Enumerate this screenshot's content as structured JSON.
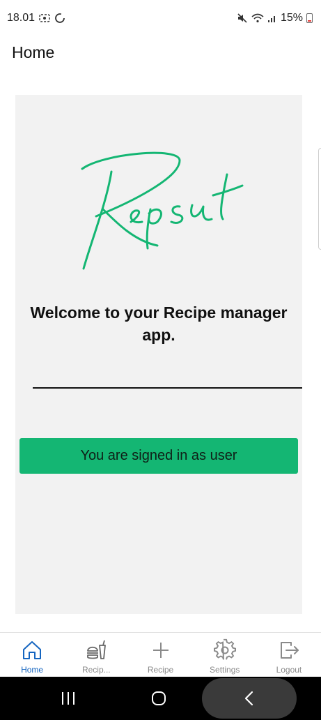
{
  "status_bar": {
    "time": "18.01",
    "battery": "15%"
  },
  "page": {
    "title": "Home"
  },
  "main": {
    "logo_text": "Repsut",
    "welcome": "Welcome to your Recipe manager app.",
    "signed_in_text": "You are signed in as user"
  },
  "tabs": [
    {
      "label": "Home",
      "icon": "home-icon",
      "active": true
    },
    {
      "label": "Recip...",
      "icon": "burger-drink-icon",
      "active": false
    },
    {
      "label": "Recipe",
      "icon": "plus-icon",
      "active": false
    },
    {
      "label": "Settings",
      "icon": "gear-icon",
      "active": false
    },
    {
      "label": "Logout",
      "icon": "logout-icon",
      "active": false
    }
  ],
  "colors": {
    "accent": "#14b673",
    "active_tab": "#1565c0",
    "card_bg": "#f2f2f2"
  }
}
